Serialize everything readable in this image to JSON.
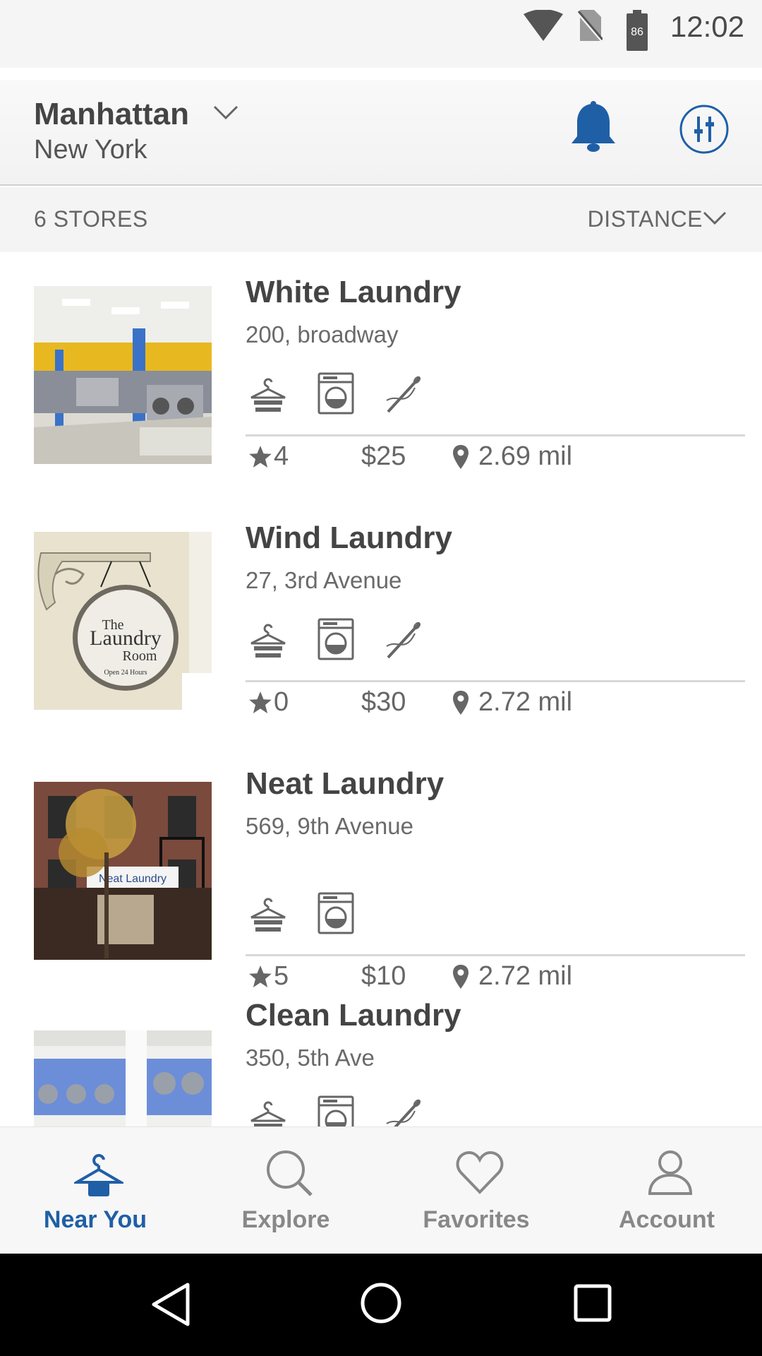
{
  "status_bar": {
    "time": "12:02",
    "battery": "86",
    "icons": [
      "wifi-icon",
      "no-sim-icon",
      "battery-icon"
    ]
  },
  "header": {
    "city": "Manhattan",
    "state": "New York"
  },
  "subheader": {
    "count": "6 STORES",
    "sort": "DISTANCE"
  },
  "colors": {
    "accent": "#1f5fa6",
    "text": "#444444",
    "muted": "#888888"
  },
  "stores": [
    {
      "name": "White Laundry",
      "address": "200, broadway",
      "rating": "4",
      "price": "$25",
      "distance": "2.69 mil",
      "amenities": [
        "hanger-icon",
        "washer-icon",
        "sewing-needle-icon"
      ]
    },
    {
      "name": "Wind Laundry",
      "address": "27, 3rd Avenue",
      "rating": "0",
      "price": "$30",
      "distance": "2.72 mil",
      "amenities": [
        "hanger-icon",
        "washer-icon",
        "sewing-needle-icon"
      ]
    },
    {
      "name": "Neat Laundry",
      "address": "569, 9th Avenue",
      "rating": "5",
      "price": "$10",
      "distance": "2.72 mil",
      "amenities": [
        "hanger-icon",
        "washer-icon"
      ]
    },
    {
      "name": "Clean Laundry",
      "address": "350, 5th Ave"
    }
  ],
  "photo_sign": {
    "line1": "The",
    "line2": "Laundry",
    "line3": "Room",
    "line4": "Open 24 Hours"
  },
  "bottom_nav": [
    {
      "label": "Near You",
      "icon": "hanger-icon",
      "active": true
    },
    {
      "label": "Explore",
      "icon": "search-icon"
    },
    {
      "label": "Favorites",
      "icon": "heart-icon"
    },
    {
      "label": "Account",
      "icon": "user-icon"
    }
  ],
  "system_nav": [
    "back-icon",
    "home-icon",
    "recents-icon"
  ]
}
